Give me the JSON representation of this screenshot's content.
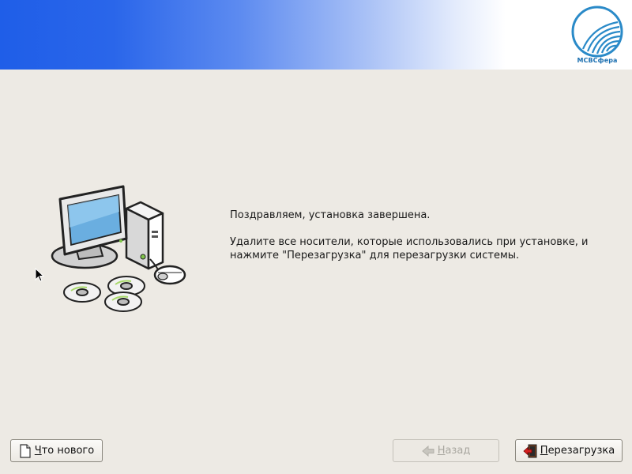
{
  "banner": {
    "logo_text": "МСВСфера"
  },
  "message": {
    "line1": "Поздравляем, установка завершена.",
    "line2": "Удалите все носители, которые использовались при установке, и",
    "line3": "нажмите \"Перезагрузка\" для перезагрузки системы."
  },
  "buttons": {
    "whats_new": {
      "mnemonic": "Ч",
      "rest": "то нового",
      "icon": "document-icon"
    },
    "back": {
      "mnemonic": "Н",
      "rest": "азад",
      "icon": "back-arrow-icon",
      "enabled": false
    },
    "reboot": {
      "mnemonic": "П",
      "rest": "ерезагрузка",
      "icon": "exit-door-icon"
    }
  },
  "illustration": {
    "icon": "computer-with-cds-icon"
  }
}
